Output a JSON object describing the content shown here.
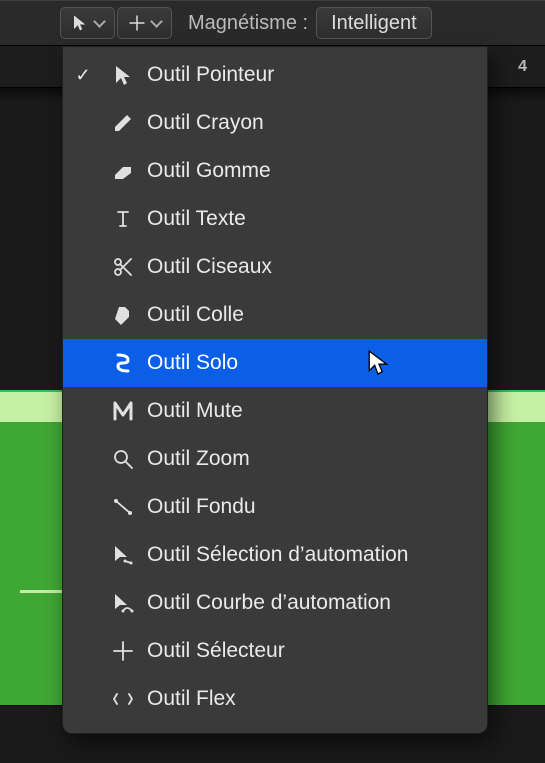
{
  "toolbar": {
    "snap_label": "Magnétisme :",
    "snap_value": "Intelligent",
    "ruler_marker": "4"
  },
  "menu": {
    "items": [
      {
        "name": "outil-pointeur",
        "label": "Outil Pointeur",
        "icon": "pointer",
        "checked": true,
        "highlight": false
      },
      {
        "name": "outil-crayon",
        "label": "Outil Crayon",
        "icon": "pencil",
        "checked": false,
        "highlight": false
      },
      {
        "name": "outil-gomme",
        "label": "Outil Gomme",
        "icon": "eraser",
        "checked": false,
        "highlight": false
      },
      {
        "name": "outil-texte",
        "label": "Outil Texte",
        "icon": "text",
        "checked": false,
        "highlight": false
      },
      {
        "name": "outil-ciseaux",
        "label": "Outil Ciseaux",
        "icon": "scissors",
        "checked": false,
        "highlight": false
      },
      {
        "name": "outil-colle",
        "label": "Outil Colle",
        "icon": "glue",
        "checked": false,
        "highlight": false
      },
      {
        "name": "outil-solo",
        "label": "Outil Solo",
        "icon": "solo",
        "checked": false,
        "highlight": true
      },
      {
        "name": "outil-mute",
        "label": "Outil Mute",
        "icon": "mute",
        "checked": false,
        "highlight": false
      },
      {
        "name": "outil-zoom",
        "label": "Outil Zoom",
        "icon": "zoom",
        "checked": false,
        "highlight": false
      },
      {
        "name": "outil-fondu",
        "label": "Outil Fondu",
        "icon": "fade",
        "checked": false,
        "highlight": false
      },
      {
        "name": "outil-selection-automation",
        "label": "Outil Sélection d’automation",
        "icon": "autosel",
        "checked": false,
        "highlight": false
      },
      {
        "name": "outil-courbe-automation",
        "label": "Outil Courbe d’automation",
        "icon": "autocurve",
        "checked": false,
        "highlight": false
      },
      {
        "name": "outil-selecteur",
        "label": "Outil Sélecteur",
        "icon": "marquee",
        "checked": false,
        "highlight": false
      },
      {
        "name": "outil-flex",
        "label": "Outil Flex",
        "icon": "flex",
        "checked": false,
        "highlight": false
      }
    ]
  }
}
